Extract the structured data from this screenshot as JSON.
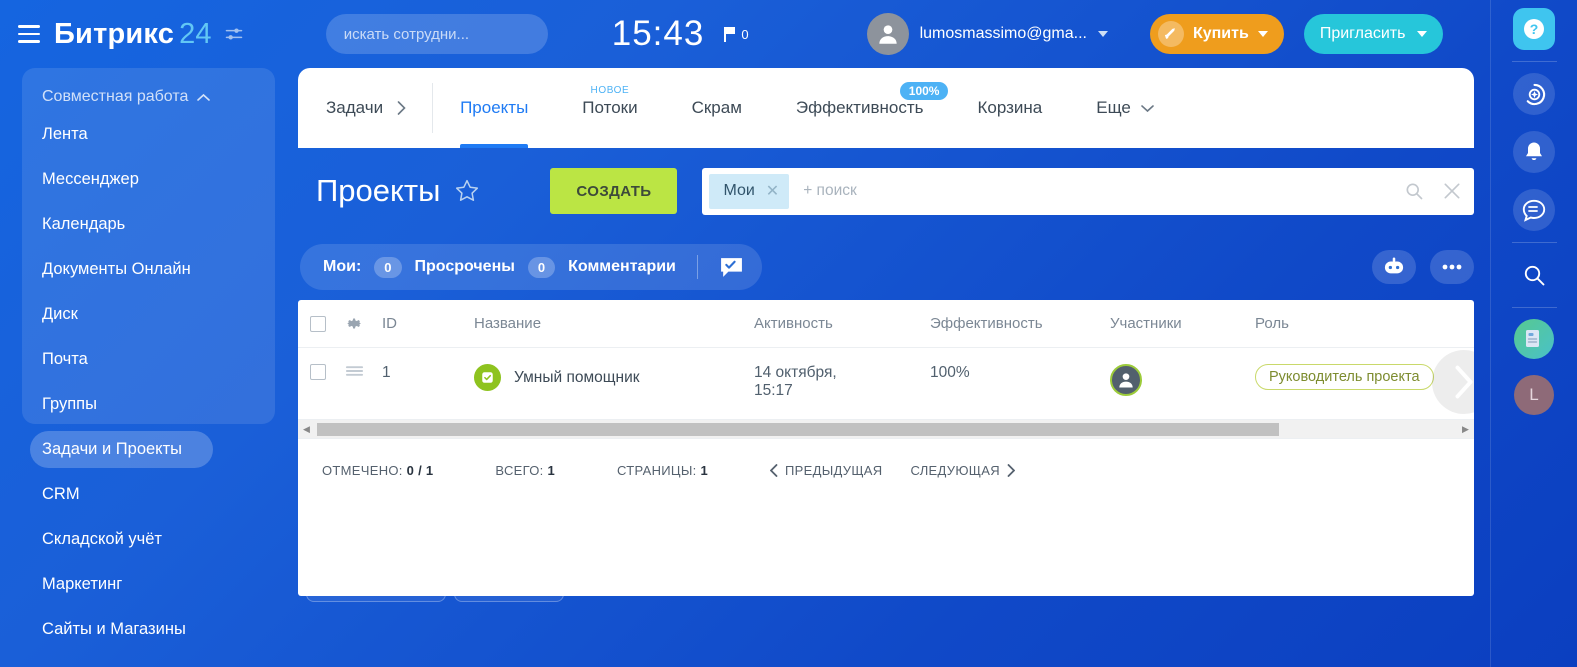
{
  "header": {
    "brand_name": "Битрикс",
    "brand_number": "24",
    "search_placeholder": "искать сотрудни...",
    "clock": "15:43",
    "flag_count": "0",
    "user_name": "lumosmassimo@gma...",
    "buy_label": "Купить",
    "invite_label": "Пригласить"
  },
  "sidebar": {
    "group_label": "Совместная работа",
    "items": [
      {
        "label": "Лента"
      },
      {
        "label": "Мессенджер"
      },
      {
        "label": "Календарь"
      },
      {
        "label": "Документы Онлайн"
      },
      {
        "label": "Диск"
      },
      {
        "label": "Почта"
      },
      {
        "label": "Группы"
      },
      {
        "label": "Задачи и Проекты"
      },
      {
        "label": "CRM"
      },
      {
        "label": "Складской учёт"
      },
      {
        "label": "Маркетинг"
      },
      {
        "label": "Сайты и Магазины"
      }
    ]
  },
  "tabs": {
    "root_label": "Задачи",
    "items": [
      {
        "label": "Проекты",
        "badge": "",
        "badge_type": ""
      },
      {
        "label": "Потоки",
        "badge": "НОВОЕ",
        "badge_type": "new"
      },
      {
        "label": "Скрам",
        "badge": "",
        "badge_type": ""
      },
      {
        "label": "Эффективность",
        "badge": "100%",
        "badge_type": "pct"
      },
      {
        "label": "Корзина",
        "badge": "",
        "badge_type": ""
      },
      {
        "label": "Еще",
        "badge": "",
        "badge_type": ""
      }
    ]
  },
  "page": {
    "title": "Проекты",
    "create_label": "СОЗДАТЬ",
    "filter_chip": "Мои",
    "filter_placeholder": "+ поиск"
  },
  "counters": {
    "label": "Мои:",
    "overdue_count": "0",
    "overdue_label": "Просрочены",
    "comments_count": "0",
    "comments_label": "Комментарии"
  },
  "table": {
    "columns": [
      "ID",
      "Название",
      "Активность",
      "Эффективность",
      "Участники",
      "Роль"
    ],
    "rows": [
      {
        "id": "1",
        "name": "Умный помощник",
        "activity": "14 октября,",
        "activity2": "15:17",
        "efficiency": "100%",
        "role": "Руководитель проекта"
      }
    ]
  },
  "pager": {
    "marked_label": "ОТМЕЧЕНО:",
    "marked_value": "0 / 1",
    "total_label": "ВСЕГО:",
    "total_value": "1",
    "pages_label": "СТРАНИЦЫ:",
    "pages_value": "1",
    "prev_label": "ПРЕДЫДУЩАЯ",
    "next_label": "СЛЕДУЮЩАЯ"
  },
  "colors": {
    "brand_blue": "#1f7bf4",
    "accent_green": "#bbe544",
    "accent_orange": "#ef9d1d",
    "accent_teal": "#26c6da",
    "badge_blue": "#4db2f5"
  }
}
